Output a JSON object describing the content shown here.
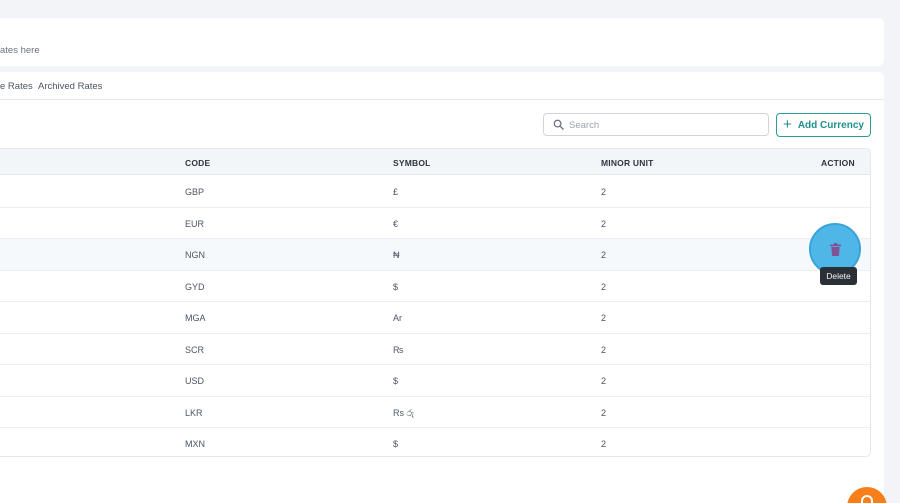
{
  "header": {
    "subtitle": "ates here"
  },
  "tabs": [
    {
      "label": "e Rates"
    },
    {
      "label": "Archived Rates"
    }
  ],
  "toolbar": {
    "search_placeholder": "Search",
    "add_label": "Add Currency"
  },
  "table": {
    "columns": {
      "code": "CODE",
      "symbol": "SYMBOL",
      "minor_unit": "MINOR UNIT",
      "action": "ACTION"
    },
    "rows": [
      {
        "code": "GBP",
        "symbol": "£",
        "minor_unit": "2"
      },
      {
        "code": "EUR",
        "symbol": "€",
        "minor_unit": "2"
      },
      {
        "code": "NGN",
        "symbol": "₦",
        "minor_unit": "2"
      },
      {
        "code": "GYD",
        "symbol": "$",
        "minor_unit": "2"
      },
      {
        "code": "MGA",
        "symbol": "Ar",
        "minor_unit": "2"
      },
      {
        "code": "SCR",
        "symbol": "₨",
        "minor_unit": "2"
      },
      {
        "code": "USD",
        "symbol": "$",
        "minor_unit": "2"
      },
      {
        "code": "LKR",
        "symbol": "Rs රු",
        "minor_unit": "2"
      },
      {
        "code": "MXN",
        "symbol": "$",
        "minor_unit": "2"
      }
    ]
  },
  "action": {
    "tooltip": "Delete"
  },
  "colors": {
    "accent": "#1f8f8c",
    "highlight": "#46b4e6",
    "fab": "#f77f1a",
    "delete_icon": "#7b4a8f"
  },
  "icons": {
    "search": "search-icon",
    "delete": "trash-icon",
    "add": "plus-icon",
    "fab": "help-icon"
  }
}
